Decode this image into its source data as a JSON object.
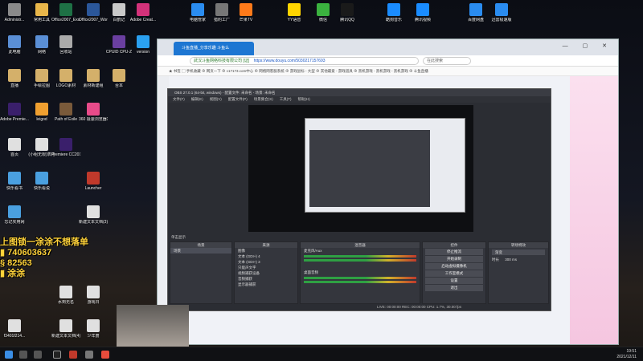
{
  "desktop_icons": [
    {
      "label": "Administr...",
      "color": "#8a8a8a"
    },
    {
      "label": "常用工具",
      "color": "#e8b64a"
    },
    {
      "label": "Office2007_Excel文档",
      "color": "#1e7145"
    },
    {
      "label": "Office2007_Word文档",
      "color": "#2b579a"
    },
    {
      "label": "白鹤记",
      "color": "#c9c9c9"
    },
    {
      "label": "Adobe Creat...",
      "color": "#d4327a"
    },
    {
      "label": "电脑管家",
      "color": "#2a8cf0"
    },
    {
      "label": "猎豹工厂",
      "color": "#777"
    },
    {
      "label": "芒果TV",
      "color": "#ff7a1a"
    },
    {
      "label": "YY语音",
      "color": "#ffd400"
    },
    {
      "label": "微信",
      "color": "#3bb23f"
    },
    {
      "label": "腾讯QQ",
      "color": "#1a1a1a"
    },
    {
      "label": "酷狗音乐",
      "color": "#1a8cff"
    },
    {
      "label": "腾讯视频",
      "color": "#1a8cff"
    },
    {
      "label": "百度网盘",
      "color": "#2a8cf0"
    },
    {
      "label": "迅雷极速版",
      "color": "#2a8cf0"
    },
    {
      "label": "此电脑",
      "color": "#5a8fd6"
    },
    {
      "label": "网络",
      "color": "#5a8fd6"
    },
    {
      "label": "回收站",
      "color": "#aaaaaa"
    },
    {
      "label": "CPUID CPU-Z",
      "color": "#6a3fa0"
    },
    {
      "label": "version",
      "color": "#2aa0f0"
    },
    {
      "label": "直播",
      "color": "#d4b06a"
    },
    {
      "label": "手绘拉图",
      "color": "#d4b06a"
    },
    {
      "label": "LOGO素材",
      "color": "#d4b06a"
    },
    {
      "label": "素材新建组",
      "color": "#d4b06a"
    },
    {
      "label": "台本",
      "color": "#d4b06a"
    },
    {
      "label": "Adobe Premie...",
      "color": "#3a1f6b"
    },
    {
      "label": "leigod",
      "color": "#f0a030"
    },
    {
      "label": "Path of Exile",
      "color": "#7a5a3a"
    },
    {
      "label": "360 极速浏览器X",
      "color": "#e94b8a"
    },
    {
      "label": "首页",
      "color": "#e0e0e0"
    },
    {
      "label": "(小组无限)表格",
      "color": "#e0e0e0"
    },
    {
      "label": "Premiere CC2019",
      "color": "#3a1f6b"
    },
    {
      "label": "快乐看书",
      "color": "#4aa0e0"
    },
    {
      "label": "快乐看说",
      "color": "#4aa0e0"
    },
    {
      "label": "Launcher",
      "color": "#c0392b"
    },
    {
      "label": "忘记实用网",
      "color": "#4aa0e0"
    },
    {
      "label": "新建文本文档(3)",
      "color": "#e0e0e0"
    },
    {
      "label": "水到无名",
      "color": "#e0e0e0"
    },
    {
      "label": "游戏日",
      "color": "#e0e0e0"
    },
    {
      "label": "f3401f214...",
      "color": "#e0e0e0"
    },
    {
      "label": "新建文本文档(4)",
      "color": "#e0e0e0"
    },
    {
      "label": "少年册",
      "color": "#e0e0e0"
    }
  ],
  "browser": {
    "tab_title": "斗鱼直播_分享乐趣 斗鱼么",
    "address_prefix": "武汉斗鱼网络科技有限公司 [证]",
    "url": "https://www.douyu.com/5030217157693",
    "search_placeholder": "在此搜索",
    "bookmarks": "★ 书签  ▢ 手机收藏  ⊕ 网页一下  ⊕ c17173.com中心  ⊕ 网络网客服系统  ⊕ 游戏鼠标 - 大型  ⊕ 其他最爱 - 游戏道具  ⊕ 黑机游戏 - 黑机游戏 - 黑机游戏  ⊕ 斗鱼直播"
  },
  "obs": {
    "title": "OBS 27.0.1 (64-bit, windows) - 配置文件: 未命名 - 场景: 未命名",
    "menu": [
      "文件(F)",
      "编辑(E)",
      "视图(V)",
      "配置文件(P)",
      "场景集合(S)",
      "工具(T)",
      "帮助(H)"
    ],
    "mix_label": "单击显示",
    "panels": {
      "scenes": {
        "header": "场景",
        "items": [
          "场景"
        ]
      },
      "sources": {
        "header": "来源",
        "items": [
          "图像",
          "文本 (GDI+) 4",
          "文本 (GDI+) 3",
          "只能声文字",
          "视频捕获设备",
          "音频捕获",
          "显示器捕获"
        ]
      },
      "mixer": {
        "header": "混音器",
        "items": [
          "麦克风/Aux",
          "桌面音频"
        ]
      },
      "transitions": {
        "header": "转场特效",
        "type": "渐变",
        "duration_label": "时长",
        "duration": "300 ms"
      },
      "controls": {
        "header": "控件",
        "buttons": [
          "停止推流",
          "开始录制",
          "启动虚拟摄像机",
          "工作室模式",
          "设置",
          "退出"
        ]
      }
    },
    "status": "LIVE: 00:00:00    REC: 00:00:00    CPU: 1.7%, 30.00 fps"
  },
  "overlay": {
    "line1": "上图锁一涂涂不想落单",
    "line2": "▮ 740603637",
    "line3": "§ 82563",
    "line4": "▮ 涂涂"
  },
  "taskbar": {
    "time": "19:51",
    "date": "2021/12/11"
  }
}
